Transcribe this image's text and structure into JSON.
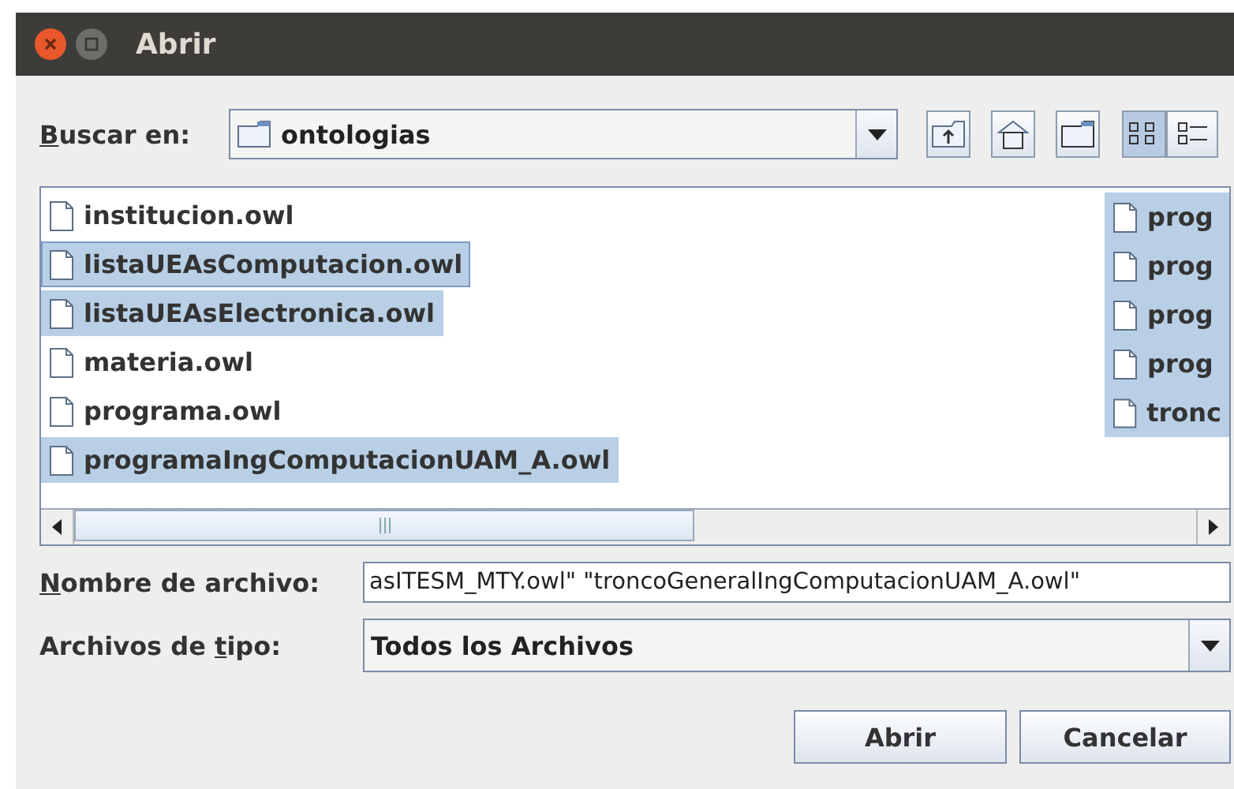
{
  "window": {
    "title": "Abrir"
  },
  "look_in": {
    "label_key": "B",
    "label_after": "uscar en:",
    "value": "ontologias"
  },
  "toolbar": [
    {
      "kind": "up",
      "selected": false
    },
    {
      "kind": "home",
      "selected": false
    },
    {
      "kind": "new-folder",
      "selected": false
    },
    {
      "kind": "list-view",
      "selected": true
    },
    {
      "kind": "details-view",
      "selected": false
    }
  ],
  "files": [
    {
      "name": "institucion.owl",
      "selected": false,
      "focused": false
    },
    {
      "name": "listaUEAsComputacion.owl",
      "selected": true,
      "focused": true
    },
    {
      "name": "listaUEAsElectronica.owl",
      "selected": true,
      "focused": false
    },
    {
      "name": "materia.owl",
      "selected": false,
      "focused": false
    },
    {
      "name": "programa.owl",
      "selected": false,
      "focused": false
    },
    {
      "name": "programaIngComputacionUAM_A.owl",
      "selected": true,
      "focused": false
    }
  ],
  "files_column_2": [
    {
      "name": "prog",
      "selected": true
    },
    {
      "name": "prog",
      "selected": true
    },
    {
      "name": "prog",
      "selected": true
    },
    {
      "name": "prog",
      "selected": true
    },
    {
      "name": "tronc",
      "selected": true
    }
  ],
  "file_name": {
    "label_key": "N",
    "label_after": "ombre de archivo:",
    "value": "asITESM_MTY.owl\" \"troncoGeneralIngComputacionUAM_A.owl\""
  },
  "file_type": {
    "label_before": "Archivos de ",
    "label_key": "t",
    "label_after": "ipo:",
    "value": "Todos los Archivos"
  },
  "buttons": [
    "Abrir",
    "Cancelar"
  ]
}
